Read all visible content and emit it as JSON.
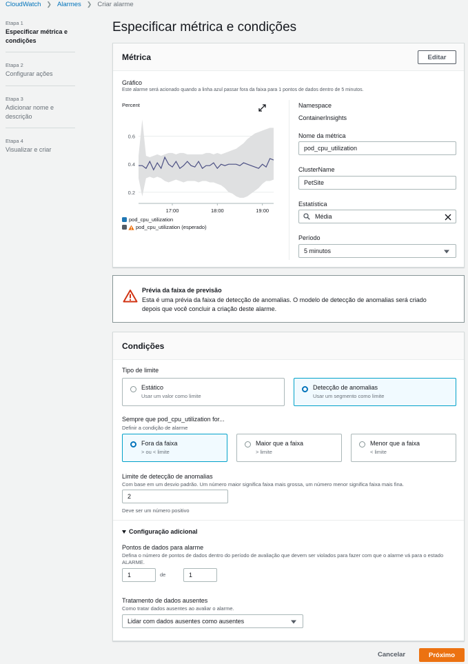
{
  "breadcrumb": [
    "CloudWatch",
    "Alarmes",
    "Criar alarme"
  ],
  "steps": [
    {
      "num": "Etapa 1",
      "label": "Especificar métrica e condições"
    },
    {
      "num": "Etapa 2",
      "label": "Configurar ações"
    },
    {
      "num": "Etapa 3",
      "label": "Adicionar nome e descrição"
    },
    {
      "num": "Etapa 4",
      "label": "Visualizar e criar"
    }
  ],
  "page_title": "Especificar métrica e condições",
  "metric": {
    "title": "Métrica",
    "edit_label": "Editar",
    "graph_title": "Gráfico",
    "graph_desc": "Este alarme será acionado quando a linha azul passar fora da faixa para 1 pontos de dados dentro de 5 minutos.",
    "namespace_label": "Namespace",
    "namespace_value": "ContainerInsights",
    "metric_name_label": "Nome da métrica",
    "metric_name_value": "pod_cpu_utilization",
    "cluster_label": "ClusterName",
    "cluster_value": "PetSite",
    "stat_label": "Estatística",
    "stat_value": "Média",
    "period_label": "Período",
    "period_value": "5 minutos"
  },
  "chart_data": {
    "type": "line",
    "ylabel": "Percent",
    "yticks": [
      0.6,
      0.4,
      0.2
    ],
    "ylim": [
      0.12,
      0.78
    ],
    "xticks": [
      {
        "label": "17:00",
        "t": 30
      },
      {
        "label": "18:00",
        "t": 90
      },
      {
        "label": "19:00",
        "t": 150
      }
    ],
    "xlim": [
      -15,
      165
    ],
    "series": [
      {
        "name": "pod_cpu_utilization",
        "color": "#1f77b4",
        "line_color": "#4b4f83",
        "t": [
          -15,
          -10,
          -5,
          0,
          5,
          10,
          15,
          20,
          25,
          30,
          35,
          40,
          45,
          50,
          55,
          60,
          65,
          70,
          75,
          80,
          85,
          90,
          95,
          100,
          105,
          110,
          115,
          120,
          125,
          130,
          135,
          140,
          145,
          150,
          155,
          160,
          165
        ],
        "values": [
          0.39,
          0.39,
          0.37,
          0.42,
          0.36,
          0.41,
          0.37,
          0.45,
          0.4,
          0.38,
          0.42,
          0.37,
          0.39,
          0.42,
          0.39,
          0.38,
          0.42,
          0.37,
          0.39,
          0.39,
          0.41,
          0.37,
          0.4,
          0.39,
          0.4,
          0.4,
          0.4,
          0.39,
          0.41,
          0.4,
          0.39,
          0.38,
          0.37,
          0.4,
          0.38,
          0.44,
          0.43
        ]
      },
      {
        "name": "pod_cpu_utilization (esperado)",
        "color": "#545b64",
        "warning": true,
        "band_upper": [
          0.46,
          0.72,
          0.46,
          0.45,
          0.46,
          0.47,
          0.46,
          0.47,
          0.48,
          0.48,
          0.47,
          0.48,
          0.48,
          0.47,
          0.47,
          0.47,
          0.47,
          0.47,
          0.48,
          0.48,
          0.47,
          0.48,
          0.47,
          0.48,
          0.49,
          0.5,
          0.51,
          0.53,
          0.55,
          0.58,
          0.6,
          0.62,
          0.63,
          0.64,
          0.65,
          0.66,
          0.66
        ],
        "band_lower": [
          0.3,
          0.17,
          0.3,
          0.31,
          0.3,
          0.31,
          0.3,
          0.28,
          0.27,
          0.28,
          0.29,
          0.28,
          0.27,
          0.28,
          0.28,
          0.28,
          0.27,
          0.28,
          0.28,
          0.27,
          0.27,
          0.26,
          0.25,
          0.23,
          0.2,
          0.19,
          0.17,
          0.16,
          0.16,
          0.17,
          0.19,
          0.21,
          0.23,
          0.26,
          0.28,
          0.28,
          0.29
        ]
      }
    ]
  },
  "alert": {
    "title": "Prévia da faixa de previsão",
    "body": "Esta é uma prévia da faixa de detecção de anomalias. O modelo de detecção de anomalias será criado depois que você concluir a criação deste alarme."
  },
  "conditions": {
    "title": "Condições",
    "threshold_type_label": "Tipo de limite",
    "threshold_options": [
      {
        "title": "Estático",
        "desc": "Usar um valor como limite",
        "selected": false
      },
      {
        "title": "Detecção de anomalias",
        "desc": "Usar um segmento como limite",
        "selected": true
      }
    ],
    "whenever_label": "Sempre que pod_cpu_utilization for...",
    "whenever_desc": "Definir a condição de alarme",
    "condition_options": [
      {
        "title": "Fora da faixa",
        "desc": "> ou < limite",
        "selected": true
      },
      {
        "title": "Maior que a faixa",
        "desc": "> limite",
        "selected": false
      },
      {
        "title": "Menor que a faixa",
        "desc": "< limite",
        "selected": false
      }
    ],
    "anomaly_label": "Limite de detecção de anomalias",
    "anomaly_desc": "Com base em um desvio padrão. Um número maior significa faixa mais grossa, um número menor significa faixa mais fina.",
    "anomaly_value": "2",
    "anomaly_hint": "Deve ser um número positivo",
    "additional_config": "Configuração adicional",
    "datapoints_label": "Pontos de dados para alarme",
    "datapoints_desc": "Defina o número de pontos de dados dentro do período de avaliação que devem ser violados para fazer com que o alarme vá para o estado ALARME.",
    "datapoints_value1": "1",
    "datapoints_of": "de",
    "datapoints_value2": "1",
    "missing_label": "Tratamento de dados ausentes",
    "missing_desc": "Como tratar dados ausentes ao avaliar o alarme.",
    "missing_value": "Lidar com dados ausentes como ausentes"
  },
  "footer": {
    "cancel_label": "Cancelar",
    "next_label": "Próximo"
  },
  "colors": {
    "link": "#0073bb",
    "primary": "#ec7211",
    "selected_border": "#00a1c9",
    "warning": "#d13212"
  }
}
